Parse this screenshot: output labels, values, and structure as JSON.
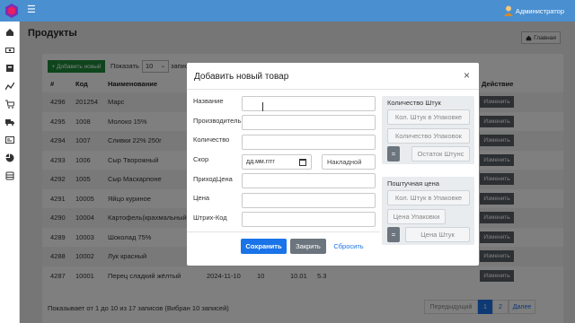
{
  "topbar": {
    "menu_icon": "hamburger-icon",
    "user_name": "Администратор"
  },
  "sidebar": {
    "icons": [
      "home-icon",
      "cash-icon",
      "box-icon",
      "chart-icon",
      "cart-icon",
      "truck-icon",
      "card-icon",
      "piechart-icon",
      "database-icon"
    ]
  },
  "page": {
    "title": "Продукты",
    "home_button": "Главная"
  },
  "toolbar": {
    "add_button": "+ Добавить новый",
    "show_label": "Показать",
    "show_value": "10",
    "show_after": "запис"
  },
  "table": {
    "headers": [
      "#",
      "Код",
      "Наименование",
      "Действие"
    ],
    "rows": [
      {
        "id": "4296",
        "code": "201254",
        "name": "Марс",
        "action": "Изменить"
      },
      {
        "id": "4295",
        "code": "1008",
        "name": "Молоко 15%",
        "action": "Изменить"
      },
      {
        "id": "4294",
        "code": "1007",
        "name": "Сливки 22% 250г",
        "action": "Изменить"
      },
      {
        "id": "4293",
        "code": "1006",
        "name": "Сыр Творожный",
        "action": "Изменить"
      },
      {
        "id": "4292",
        "code": "1005",
        "name": "Сыр Маскарпоне",
        "action": "Изменить"
      },
      {
        "id": "4291",
        "code": "10005",
        "name": "Яйцо куриное",
        "action": "Изменить"
      },
      {
        "id": "4290",
        "code": "10004",
        "name": "Картофель(крахмальный)",
        "action": "Изменить"
      },
      {
        "id": "4289",
        "code": "10003",
        "name": "Шоколад 75%",
        "action": "Изменить"
      },
      {
        "id": "4288",
        "code": "10002",
        "name": "Лук красный",
        "action": "Изменить"
      },
      {
        "id": "4287",
        "code": "10001",
        "name": "Перец сладкий жёлтый",
        "date": "2024-11-10",
        "qty": "10",
        "price": "10.01",
        "extra": "5.3",
        "action": "Изменить"
      }
    ],
    "footer": "Показывает от 1 до 10 из 17 записов (Вибран 10 записей)",
    "pager": {
      "prev": "Передыдущий",
      "page1": "1",
      "page2": "2",
      "next": "Далее"
    }
  },
  "modal": {
    "title": "Добавить новый товар",
    "close": "×",
    "fields": {
      "name_label": "Название",
      "producer_label": "Производитель",
      "qty_label": "Количество",
      "skor_label": "Скор",
      "date_placeholder": "дд.мм.гггг",
      "nakladnoy": "Накладной",
      "price_in_label": "ПриходЦена",
      "price_label": "Цена",
      "barcode_label": "Штрих-Код"
    },
    "qty_panel": {
      "title": "Количество Штук",
      "per_pack": "Кол. Штук в Упаковке",
      "pack_count": "Количество Упаковок",
      "eq": "=",
      "rest": "Остаток Штунс"
    },
    "unit_panel": {
      "title": "Поштучная цена",
      "per_pack": "Кол. Штук в Упаковке",
      "pack_price": "Цена Упаковки",
      "eq": "=",
      "unit_price": "Цена Штук"
    },
    "buttons": {
      "save": "Сохранить",
      "close": "Закрить",
      "reset": "Сбросить"
    }
  },
  "colors": {
    "topbar": "#4a8fd0",
    "primary": "#1a73e8",
    "success": "#1f8a3b",
    "secondary": "#6c757d"
  }
}
